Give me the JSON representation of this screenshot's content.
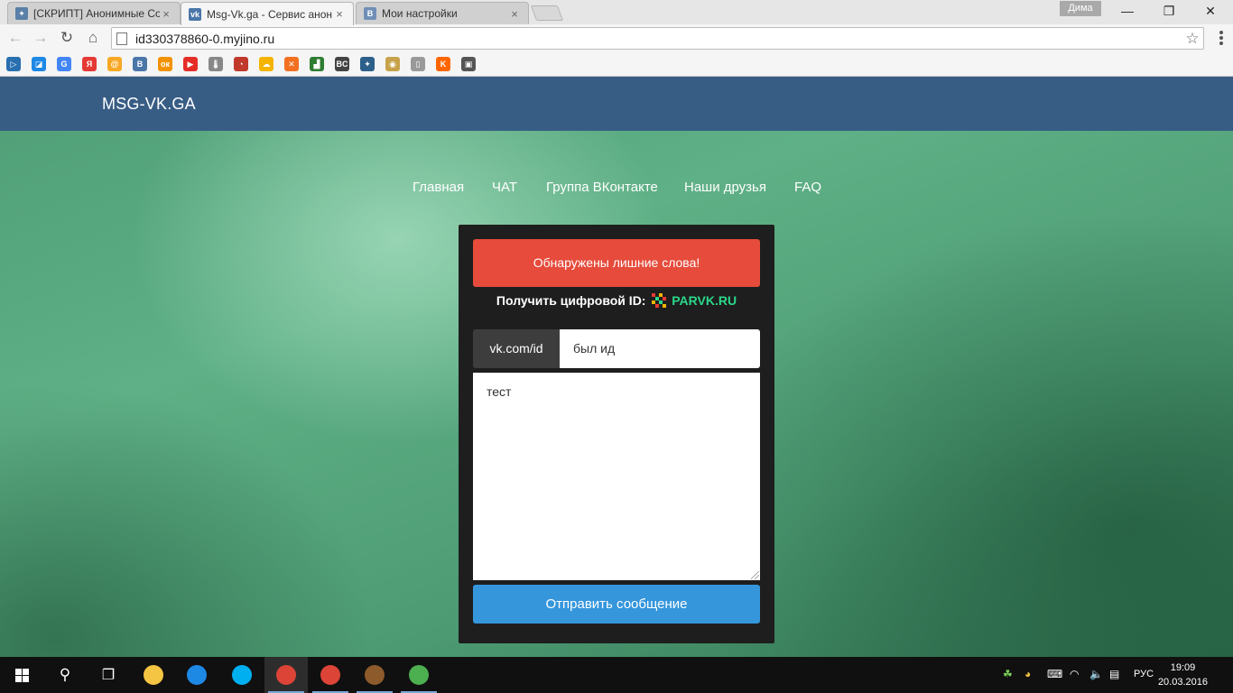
{
  "browser": {
    "tabs": [
      {
        "title": "[СКРИПТ] Анонимные Со",
        "active": false
      },
      {
        "title": "Msg-Vk.ga - Сервис анон",
        "active": true
      },
      {
        "title": "Мои настройки",
        "active": false
      }
    ],
    "tab_close_glyph": "×",
    "profile_name": "Дима",
    "address": "id330378860-0.myjino.ru",
    "bookmarks": [
      {
        "icon": "tubed-icon",
        "glyph": "▷",
        "color": "#2a6fb0"
      },
      {
        "icon": "zoho-icon",
        "glyph": "◪",
        "color": "#1e88e5"
      },
      {
        "icon": "google-icon",
        "glyph": "G",
        "color": "#4285f4"
      },
      {
        "icon": "yandex-icon",
        "glyph": "Я",
        "color": "#e53935"
      },
      {
        "icon": "mailru-icon",
        "glyph": "@",
        "color": "#f9a825"
      },
      {
        "icon": "vk-icon",
        "glyph": "В",
        "color": "#4a76a8"
      },
      {
        "icon": "odnoklassniki-icon",
        "glyph": "ок",
        "color": "#f39200"
      },
      {
        "icon": "youtube-icon",
        "glyph": "▶",
        "color": "#e52d27"
      },
      {
        "icon": "thermometer-icon",
        "glyph": "🌡",
        "color": "#888888"
      },
      {
        "icon": "speedometer-icon",
        "glyph": "◔",
        "color": "#c0392b"
      },
      {
        "icon": "cloud-icon",
        "glyph": "☁",
        "color": "#f4b400"
      },
      {
        "icon": "xing-icon",
        "glyph": "✕",
        "color": "#f37021"
      },
      {
        "icon": "stairs-icon",
        "glyph": "▟",
        "color": "#2e7d32"
      },
      {
        "icon": "bc-icon",
        "glyph": "BC",
        "color": "#444444"
      },
      {
        "icon": "wot-icon",
        "glyph": "✦",
        "color": "#2c5f8a"
      },
      {
        "icon": "world-icon",
        "glyph": "◉",
        "color": "#c7a24a"
      },
      {
        "icon": "page-icon",
        "glyph": "▯",
        "color": "#999999"
      },
      {
        "icon": "kinopoisk-icon",
        "glyph": "K",
        "color": "#ff6600"
      },
      {
        "icon": "clipboard-icon",
        "glyph": "▣",
        "color": "#555555"
      }
    ]
  },
  "site": {
    "brand": "MSG-VK.GA",
    "nav": [
      "Главная",
      "ЧАТ",
      "Группа ВКонтакте",
      "Наши друзья",
      "FAQ"
    ],
    "alert": "Обнаружены лишние слова!",
    "promo_label": "Получить цифровой ID:",
    "promo_brand": "PARVK.RU",
    "id_prefix": "vk.com/id",
    "id_value": "был ид",
    "message": "тест",
    "send_label": "Отправить сообщение"
  },
  "taskbar": {
    "apps": [
      {
        "name": "taskbar-file-explorer",
        "icon": "file-explorer-icon",
        "color": "#f4c542"
      },
      {
        "name": "taskbar-zona",
        "icon": "zona-icon",
        "color": "#1e88e5"
      },
      {
        "name": "taskbar-skype",
        "icon": "skype-icon",
        "color": "#00aff0"
      },
      {
        "name": "taskbar-chrome-1",
        "icon": "chrome-icon",
        "color": "#db4437"
      },
      {
        "name": "taskbar-chrome-2",
        "icon": "chrome-icon",
        "color": "#db4437"
      },
      {
        "name": "taskbar-game",
        "icon": "game-icon",
        "color": "#8d5a2b"
      },
      {
        "name": "taskbar-icq",
        "icon": "icq-icon",
        "color": "#4caf50"
      }
    ],
    "language": "РУС",
    "time": "19:09",
    "date": "20.03.2016"
  }
}
